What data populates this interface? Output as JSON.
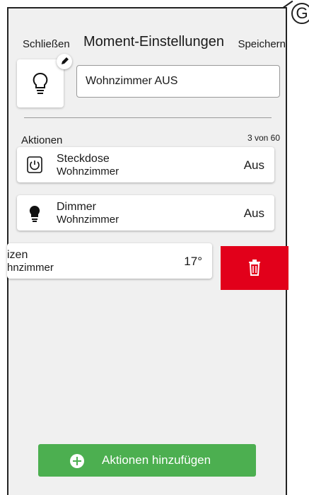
{
  "callout_label": "G",
  "header": {
    "close_label": "Schließen",
    "title": "Moment-Einstellungen",
    "save_label": "Speichern"
  },
  "moment": {
    "icon": "lightbulb-outline-icon",
    "name": "Wohnzimmer AUS"
  },
  "actions_section": {
    "label": "Aktionen",
    "count": "3 von 60"
  },
  "actions": [
    {
      "icon": "power-socket-icon",
      "name": "Steckdose",
      "room": "Wohnzimmer",
      "value": "Aus"
    },
    {
      "icon": "lightbulb-filled-icon",
      "name": "Dimmer",
      "room": "Wohnzimmer",
      "value": "Aus"
    },
    {
      "name": "izen",
      "room": "hnzimmer",
      "value": "17°"
    }
  ],
  "add_button": {
    "label": "Aktionen hinzufügen"
  },
  "colors": {
    "delete": "#e2001a",
    "add": "#4caf50"
  }
}
